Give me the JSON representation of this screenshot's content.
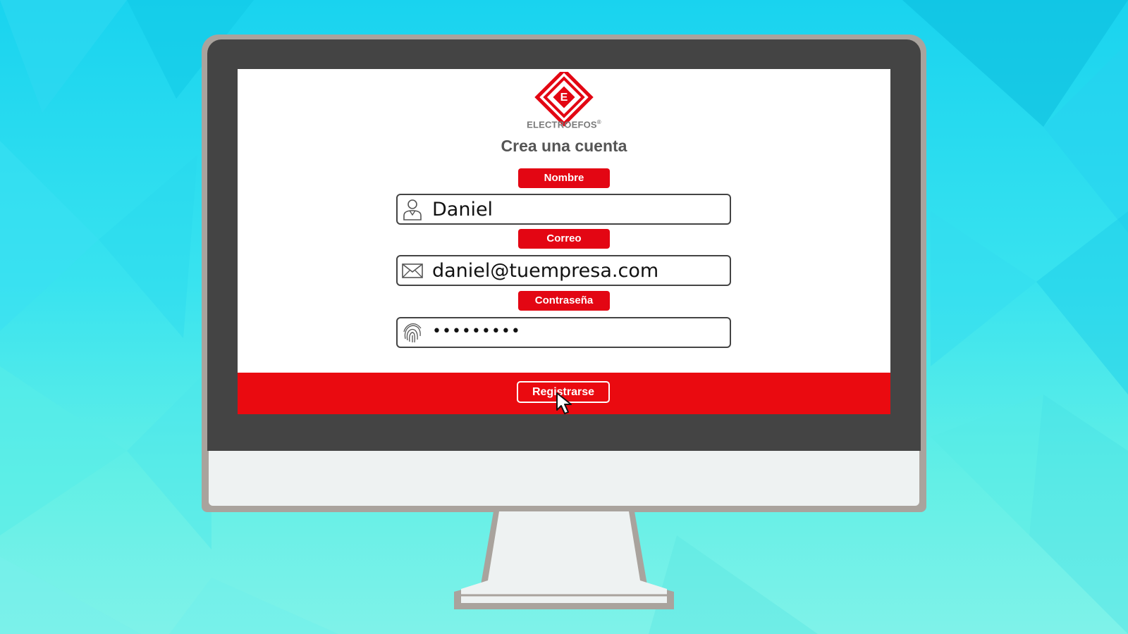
{
  "brand": {
    "name_prefix": "ELECTRO",
    "name_suffix": "EFOS",
    "registered_mark": "®",
    "logo_icon": "diamond-e-logo",
    "accent_color": "#e30613"
  },
  "form": {
    "title": "Crea una cuenta",
    "fields": [
      {
        "label": "Nombre",
        "icon": "user-icon",
        "value": "Daniel"
      },
      {
        "label": "Correo",
        "icon": "envelope-icon",
        "value": "daniel@tuempresa.com"
      },
      {
        "label": "Contraseña",
        "icon": "fingerprint-icon",
        "value": "•••••••••"
      }
    ],
    "submit_label": "Registrarse"
  },
  "cursor": {
    "icon": "mouse-pointer-icon"
  }
}
